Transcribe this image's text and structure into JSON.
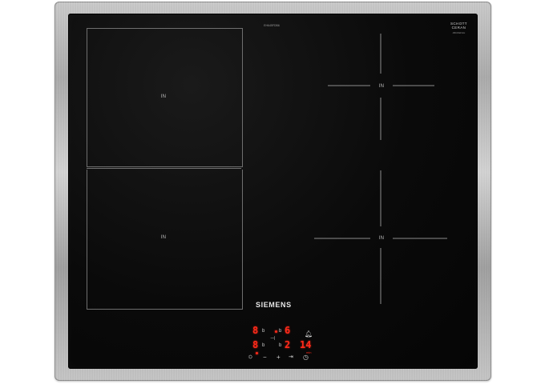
{
  "product": {
    "brand": "SIEMENS",
    "model_code": "EH645FDB6",
    "glass_logo": [
      "SCHOTT",
      "CERAN"
    ],
    "glass_logo_sub": "ABCDEFGH"
  },
  "zones": [
    {
      "id": "front-left-top",
      "label": "IN"
    },
    {
      "id": "front-left-bottom",
      "label": "IN"
    },
    {
      "id": "right-top",
      "label": "IN"
    },
    {
      "id": "right-bottom",
      "label": "IN"
    }
  ],
  "controls": {
    "display_row1": {
      "left": "8",
      "left_unit": "b",
      "right": "6",
      "right_unit": "b"
    },
    "display_row2": {
      "left": "8",
      "left_unit": "b",
      "right": "2",
      "timer": "14",
      "timer_unit": "min"
    },
    "icons": [
      "lock-icon",
      "bell-icon",
      "minus-icon",
      "plus-icon",
      "boost-icon",
      "clock-icon",
      "power-icon",
      "sliders-icon"
    ],
    "colors": {
      "display": "#ff2a1a",
      "glass": "#0a0a0a",
      "frame": "#b5b5b5"
    }
  }
}
